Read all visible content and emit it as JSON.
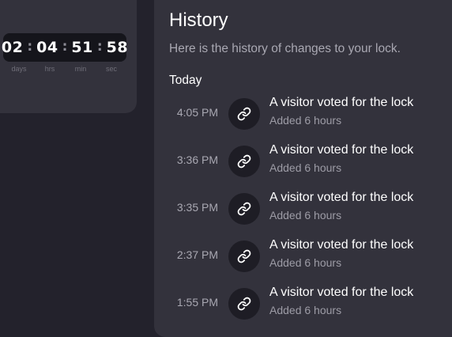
{
  "countdown": {
    "days": "02",
    "hours": "04",
    "minutes": "51",
    "seconds": "58",
    "labels": {
      "days": "days",
      "hours": "hrs",
      "minutes": "min",
      "seconds": "sec"
    }
  },
  "history": {
    "title": "History",
    "subtitle": "Here is the history of changes to your lock.",
    "section_label": "Today",
    "entries": [
      {
        "time": "4:05 PM",
        "icon": "link-icon",
        "title": "A visitor voted for the lock",
        "detail": "Added 6 hours"
      },
      {
        "time": "3:36 PM",
        "icon": "link-icon",
        "title": "A visitor voted for the lock",
        "detail": "Added 6 hours"
      },
      {
        "time": "3:35 PM",
        "icon": "link-icon",
        "title": "A visitor voted for the lock",
        "detail": "Added 6 hours"
      },
      {
        "time": "2:37 PM",
        "icon": "link-icon",
        "title": "A visitor voted for the lock",
        "detail": "Added 6 hours"
      },
      {
        "time": "1:55 PM",
        "icon": "link-icon",
        "title": "A visitor voted for the lock",
        "detail": "Added 6 hours"
      }
    ]
  }
}
